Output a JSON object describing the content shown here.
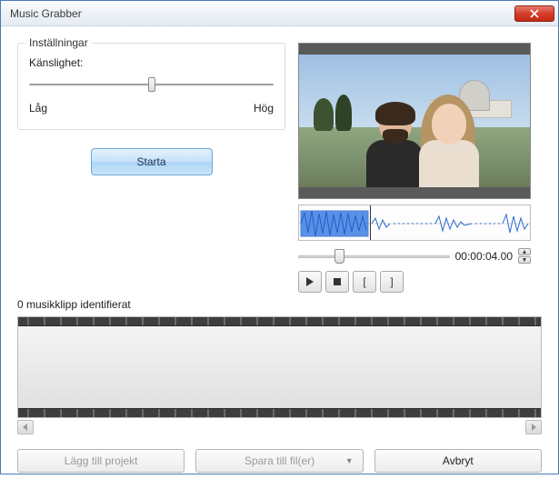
{
  "window": {
    "title": "Music Grabber"
  },
  "settings": {
    "group_label": "Inställningar",
    "sensitivity_label": "Känslighet:",
    "low_label": "Låg",
    "high_label": "Hög"
  },
  "actions": {
    "start": "Starta"
  },
  "playback": {
    "timecode": "00:00:04.00"
  },
  "clips": {
    "identified": "0 musikklipp identifierat"
  },
  "buttons": {
    "add_to_project": "Lägg till projekt",
    "save_to_files": "Spara till fil(er)",
    "cancel": "Avbryt"
  }
}
